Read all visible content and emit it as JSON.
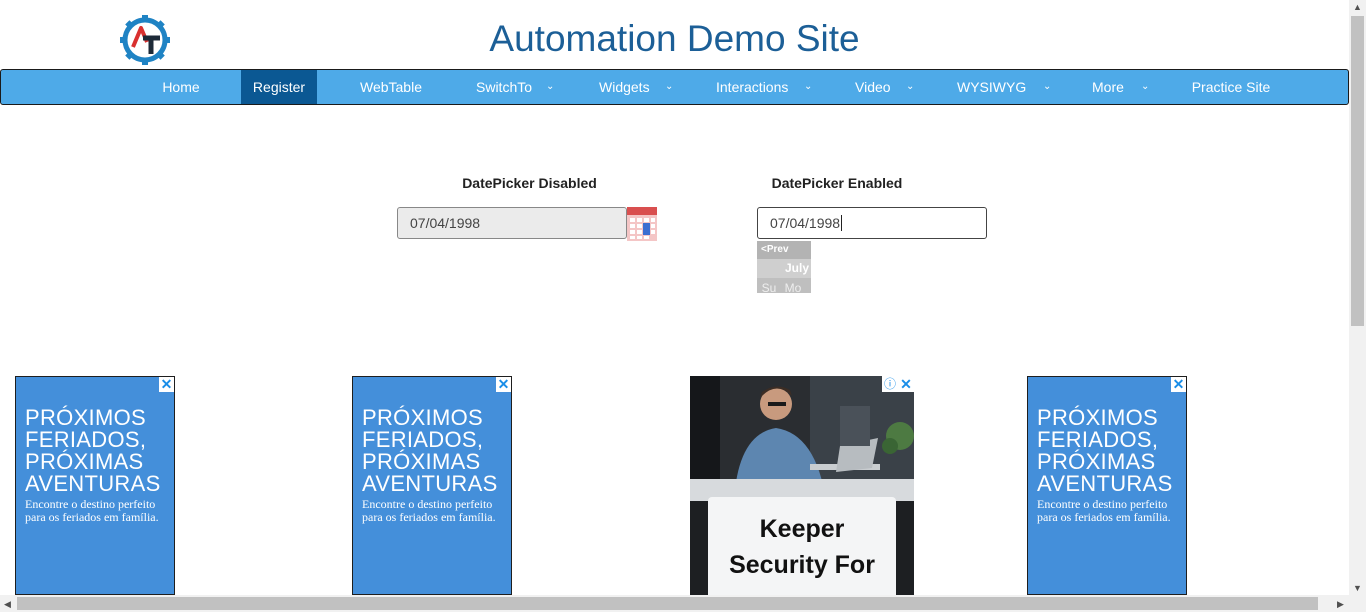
{
  "header": {
    "title": "Automation Demo Site",
    "logo_icon": "gear-logo-icon",
    "logo_colors": {
      "gear": "#1f83c4",
      "letter_a": "#d9302f",
      "letter_t": "#1d2a38"
    }
  },
  "nav": {
    "active": "Register",
    "items": [
      {
        "label": "Home"
      },
      {
        "label": "Register"
      },
      {
        "label": "WebTable"
      },
      {
        "label": "SwitchTo",
        "dropdown": true
      },
      {
        "label": "Widgets",
        "dropdown": true
      },
      {
        "label": "Interactions",
        "dropdown": true
      },
      {
        "label": "Video",
        "dropdown": true
      },
      {
        "label": "WYSIWYG",
        "dropdown": true
      },
      {
        "label": "More",
        "dropdown": true
      },
      {
        "label": "Practice Site"
      }
    ],
    "chevron": "⌄"
  },
  "datepicker_disabled": {
    "label": "DatePicker Disabled",
    "value": "07/04/1998",
    "button_icon": "calendar-icon"
  },
  "datepicker_enabled": {
    "label": "DatePicker Enabled",
    "value": "07/04/1998",
    "popup": {
      "prev": "<Prev",
      "month": "July",
      "weekdays": [
        "Su",
        "Mo"
      ]
    }
  },
  "ads": [
    {
      "headline_lines": [
        "PRÓXIMOS",
        "FERIADOS,",
        "PRÓXIMAS",
        "AVENTURAS"
      ],
      "body": "Encontre o destino perfeito para os feriados em família.",
      "close": "✕"
    },
    {
      "headline_lines": [
        "PRÓXIMOS",
        "FERIADOS,",
        "PRÓXIMAS",
        "AVENTURAS"
      ],
      "body": "Encontre o destino perfeito para os feriados em família.",
      "close": "✕"
    },
    {
      "card_lines": [
        "Keeper",
        "Security For"
      ],
      "close": "✕",
      "info_icon": "info-icon"
    },
    {
      "headline_lines": [
        "PRÓXIMOS",
        "FERIADOS,",
        "PRÓXIMAS",
        "AVENTURAS"
      ],
      "body": "Encontre o destino perfeito para os feriados em família.",
      "close": "✕"
    }
  ],
  "colors": {
    "nav_bg": "#4eaae8",
    "nav_active": "#0b5893",
    "title": "#1c5f97",
    "ad_bg": "#448fda"
  }
}
